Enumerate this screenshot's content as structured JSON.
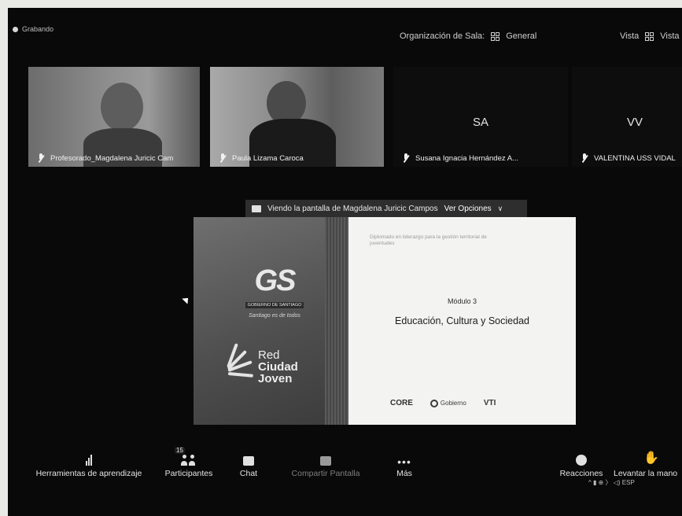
{
  "recording": {
    "label": "Grabando"
  },
  "topbar": {
    "breakout_label": "Organización de Sala:",
    "breakout_value": "General",
    "view_label": "Vista",
    "view_value": "Vista"
  },
  "participants_tiles": [
    {
      "name": "Profesorado_Magdalena Juricic Cam",
      "initials": ""
    },
    {
      "name": "Paula Lizama Caroca",
      "initials": ""
    },
    {
      "name": "Susana Ignacia Hernández A...",
      "initials": "SA"
    },
    {
      "name": "VALENTINA USS VIDAL",
      "initials": "VV"
    }
  ],
  "share_banner": {
    "text": "Viendo la pantalla de Magdalena Juricic Campos",
    "options": "Ver Opciones"
  },
  "slide": {
    "logo": "GS",
    "logo_tag": "GOBIERNO DE SANTIAGO",
    "logo_signature": "Santiago es de todos",
    "red_title": "Red",
    "red_line2": "Ciudad",
    "red_line3": "Joven",
    "small_text": "Diplomado en liderazgo para la gestión territorial de juventudes",
    "module": "Módulo 3",
    "title": "Educación, Cultura y Sociedad",
    "logos": [
      "CORE",
      "Gobierno",
      "VTI"
    ]
  },
  "toolbar": {
    "learning_tools": "Herramientas de aprendizaje",
    "participants": "Participantes",
    "participants_count": "15",
    "chat": "Chat",
    "share_screen": "Compartir Pantalla",
    "more": "Más",
    "reactions": "Reacciones",
    "raise_hand": "Levantar la mano"
  },
  "system_tray": {
    "items": "^ ▮ ⊕ 〉 ◁) ESP"
  }
}
